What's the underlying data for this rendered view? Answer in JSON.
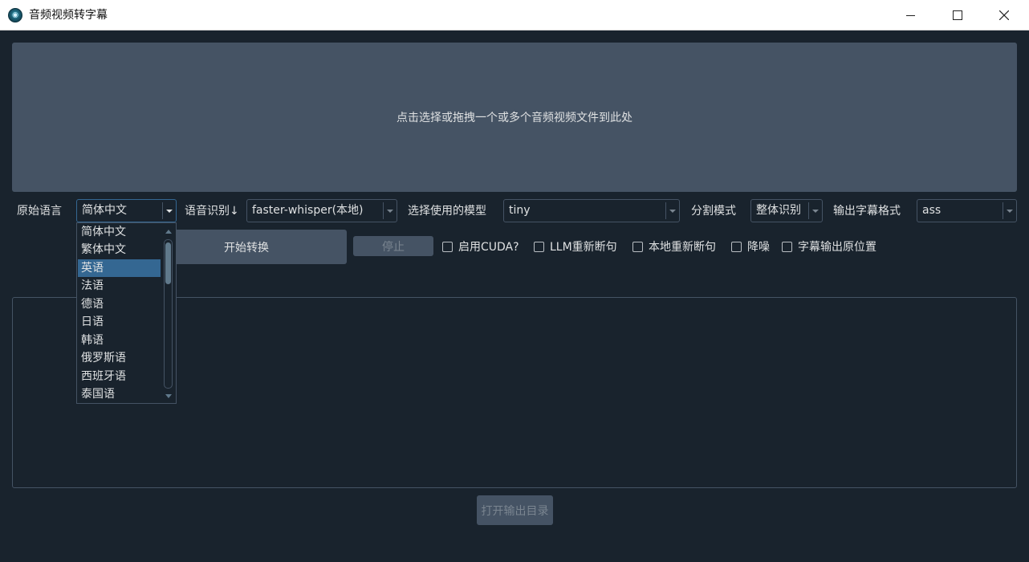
{
  "window": {
    "title": "音频视频转字幕"
  },
  "dropzone": {
    "text": "点击选择或拖拽一个或多个音频视频文件到此处"
  },
  "settings": {
    "source_language_label": "原始语言",
    "source_language_value": "简体中文",
    "asr_label": "语音识别↓",
    "asr_value": "faster-whisper(本地)",
    "model_label": "选择使用的模型",
    "model_value": "tiny",
    "split_label": "分割模式",
    "split_value": "整体识别",
    "format_label": "输出字幕格式",
    "format_value": "ass"
  },
  "actions": {
    "start_label": "开始转换",
    "stop_label": "停止",
    "open_output_label": "打开输出目录"
  },
  "options": [
    {
      "label": "启用CUDA?",
      "checked": false
    },
    {
      "label": "LLM重新断句",
      "checked": false
    },
    {
      "label": "本地重新断句",
      "checked": false
    },
    {
      "label": "降噪",
      "checked": false
    },
    {
      "label": "字幕输出原位置",
      "checked": false
    }
  ],
  "language_dropdown": {
    "selected": "英语",
    "items": [
      "简体中文",
      "繁体中文",
      "英语",
      "法语",
      "德语",
      "日语",
      "韩语",
      "俄罗斯语",
      "西班牙语",
      "泰国语"
    ]
  },
  "colors": {
    "background": "#19232d",
    "panel": "#455364",
    "selection": "#346792",
    "text": "#dfe1e2"
  }
}
